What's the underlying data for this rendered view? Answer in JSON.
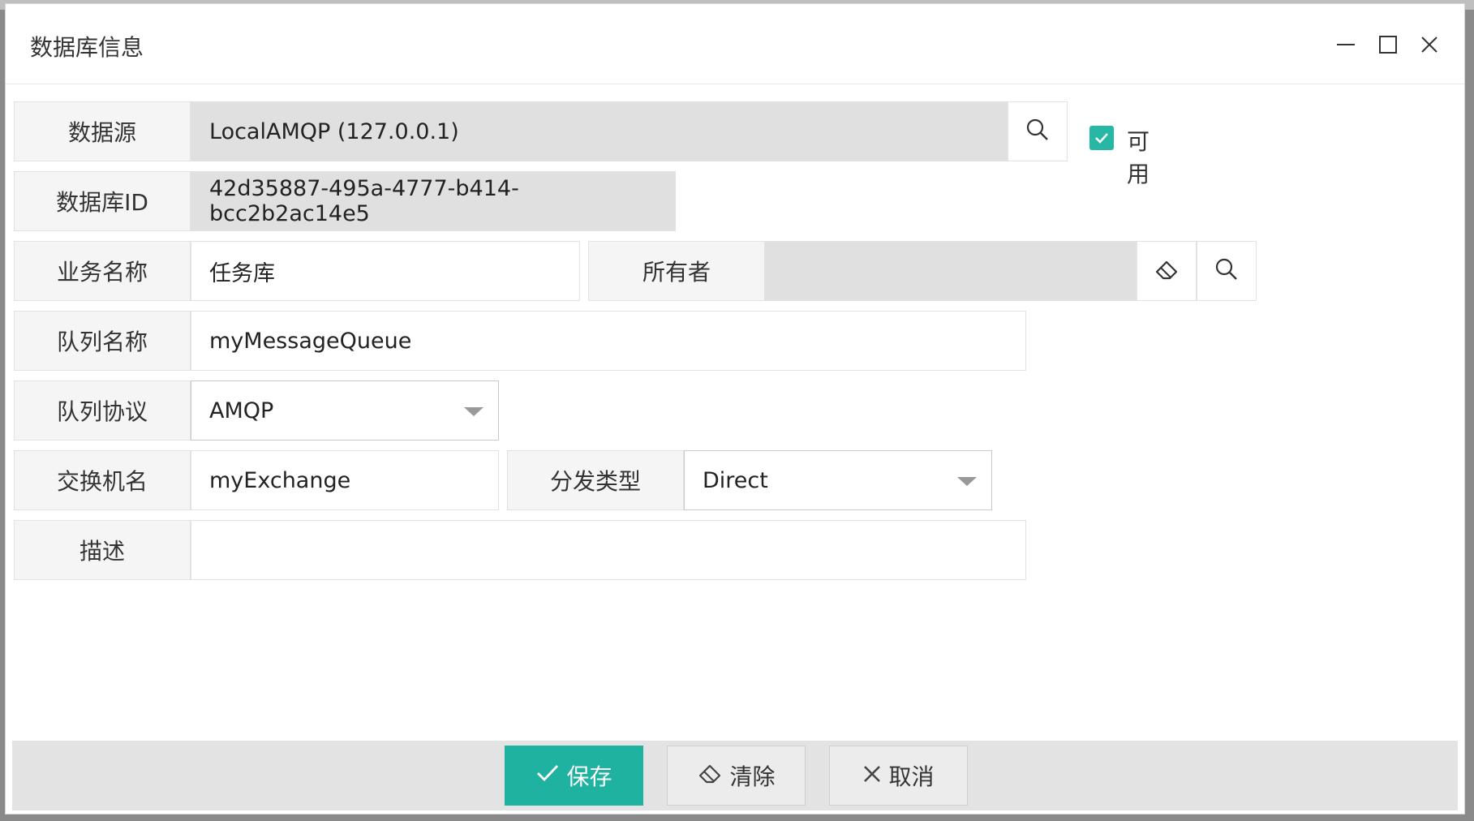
{
  "dialog": {
    "title": "数据库信息",
    "minimize_icon": "minimize-icon",
    "maximize_icon": "maximize-icon",
    "close_icon": "close-icon"
  },
  "form": {
    "datasource": {
      "label": "数据源",
      "value": "LocalAMQP (127.0.0.1)",
      "icon": "search-icon"
    },
    "enabled": {
      "label": "可用",
      "checked": true
    },
    "database_id": {
      "label": "数据库ID",
      "value": "42d35887-495a-4777-b414-bcc2b2ac14e5"
    },
    "business_name": {
      "label": "业务名称",
      "value": "任务库"
    },
    "owner": {
      "label": "所有者",
      "value": "",
      "clear_icon": "eraser-icon",
      "search_icon": "search-icon"
    },
    "queue_name": {
      "label": "队列名称",
      "value": "myMessageQueue"
    },
    "queue_protocol": {
      "label": "队列协议",
      "value": "AMQP"
    },
    "exchange_name": {
      "label": "交换机名",
      "value": "myExchange"
    },
    "dispatch_type": {
      "label": "分发类型",
      "value": "Direct"
    },
    "description": {
      "label": "描述",
      "value": ""
    }
  },
  "footer": {
    "save_label": "保存",
    "clear_label": "清除",
    "cancel_label": "取消"
  },
  "colors": {
    "accent": "#1fb2a0",
    "readonly_bg": "#e0e0e0",
    "label_bg": "#f5f5f5"
  }
}
